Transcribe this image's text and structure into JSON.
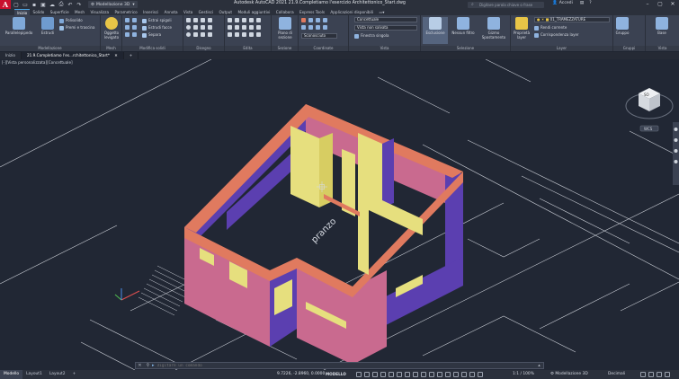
{
  "app": {
    "logo_letter": "A",
    "workspace": "Modellazione 3D",
    "title": "Autodesk AutoCAD 2021    21.9.Completiamo l'esercizio Architettonico_Start.dwg",
    "search_placeholder": "Digitare parola chiave o frase",
    "account": "Accedi"
  },
  "tabs": [
    "Inizio",
    "Solido",
    "Superficie",
    "Mesh",
    "Visualizza",
    "Parametrico",
    "Inserisci",
    "Annota",
    "Vista",
    "Gestisci",
    "Output",
    "Moduli aggiuntivi",
    "Collabora",
    "Express Tools",
    "Applicazioni disponibili"
  ],
  "active_tab": 0,
  "ribbon": {
    "modellazione": {
      "title": "Modellazione",
      "box": "Parallelepipedo",
      "extrude": "Estrudi",
      "polysolid": "Polisolido",
      "presspull": "Premi e trascina"
    },
    "mesh": {
      "title": "Mesh",
      "smooth": "Oggetto levigato"
    },
    "modifica_solidi": {
      "title": "Modifica solidi",
      "extract_edges": "Estrai spigoli",
      "extrude_faces": "Estrudi facce",
      "separate": "Separa"
    },
    "disegno_title": "Disegno",
    "edita_title": "Edita",
    "sezione": {
      "title": "Sezione",
      "plane": "Piano di sezione"
    },
    "coordinate": {
      "title": "Coordinate",
      "ucs": "Sconosciuto"
    },
    "vista": {
      "title": "Vista",
      "visual_style": "Concettuale",
      "saved_view": "Vista non salvata",
      "viewport": "Finestra singola"
    },
    "selezione": {
      "title": "Selezione",
      "isolate": "Esclusione",
      "no_filter": "Nessun filtro",
      "gizmo": "Gizmo Spostamento"
    },
    "layer": {
      "title": "Layer",
      "props": "Proprietà layer",
      "current": "01_TRAMEZZATURE",
      "make_current": "Rendi corrente",
      "match": "Corrispondenza layer"
    },
    "gruppi": {
      "title": "Gruppi",
      "group": "Gruppo"
    },
    "vista2": {
      "title": "Vista",
      "base": "Base"
    }
  },
  "file_tabs": [
    "Inizio",
    "21.9.Completiamo l'es...rchitettonico_Start*"
  ],
  "viewport": {
    "label": "[-][Vista personalizzata][Concettuale]",
    "room_label": "pranzo",
    "viewcube": "SO",
    "wcs": "WCS"
  },
  "command": {
    "placeholder": "Digitare un comando"
  },
  "status": {
    "layouts": [
      "Modello",
      "Layout1",
      "Layout2"
    ],
    "coords": "9.7226, -2.8960, 0.0000",
    "model": "MODELLO",
    "scale": "1:1 / 100%",
    "workspace": "Modellazione 3D",
    "units": "Decimali"
  },
  "colors": {
    "wall_top": "#e07a5f",
    "wall_purple": "#5b3fb0",
    "wall_pink": "#c96a8f",
    "partition": "#e6df7e",
    "ribbon_bg": "#3b4252",
    "viewport_bg": "#212734"
  }
}
